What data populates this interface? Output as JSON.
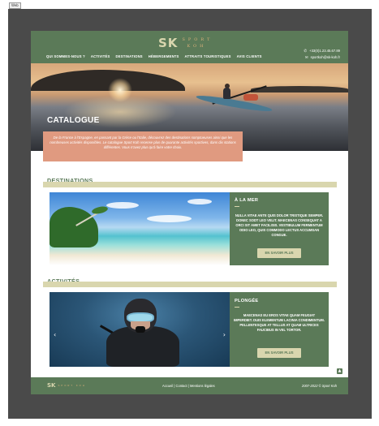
{
  "tab": "Web",
  "brand": {
    "sk": "SK",
    "line1": "SPORT",
    "line2": "KOH"
  },
  "nav": [
    "QUI SOMMES-NOUS ?",
    "ACTIVITÉS",
    "DESTINATIONS",
    "HÉBERGEMENTS",
    "ATTRAITS TOURISTIQUES",
    "AVIS CLIENTS"
  ],
  "contact": {
    "phone": "+33(0)1.23.45.67.89",
    "email": "sportkoh@sk-koh.fr"
  },
  "hero": {
    "title": "CATALOGUE",
    "intro": "De la France à l'Espagne, en passant par la Grèce ou l'Italie, découvrez des destinations somptueuses ainsi que les nombreuses activités disponibles. Le catalogue Sport Koh recense plus de quarante activités sportives, dans dix stations différentes. Vous n'avez plus qu'à faire votre choix."
  },
  "destinations": {
    "title": "DESTINATIONS",
    "card": {
      "title": "À LA MER",
      "text": "NULLA VITAE ANTE QUIS DOLOR TRISTIQUE SEMPER. DONEC SODT LEO VELIT. MAECENAS CONSEQUAT A ORCI SIT AMET FACILISIS. VESTIBULUM FERMENTUM ODIO LEO, QUIS COMMODO LECTUS ACCUMSAN CONGUE.",
      "button": "EN SAVOIR PLUS"
    }
  },
  "activities": {
    "title": "ACTIVITÉS",
    "card": {
      "title": "PLONGÉE",
      "text": "MAECENAS EU EROS VITAE QUAM FEUGIAT IMPERDIET. DUIS ELEMENTUM LACINIA CONDIMENTUM. PELLENTESQUE AT TELLUS AT QUAM ULTRICES FAUCIBUS IN VEL TORTOR.",
      "button": "EN SAVOIR PLUS",
      "prev": "‹",
      "next": "›"
    }
  },
  "scroll_top": "▲",
  "footer": {
    "sk": "SK",
    "tagline": "SPORT KOH",
    "links": "Accueil | Contact | Mentions légales",
    "copyright": "2007-2022 © Sport Koh"
  },
  "colors": {
    "green": "#5b7a58",
    "cream": "#d9d6ae",
    "salmon": "#e09a80",
    "frame": "#4a4a4a"
  }
}
